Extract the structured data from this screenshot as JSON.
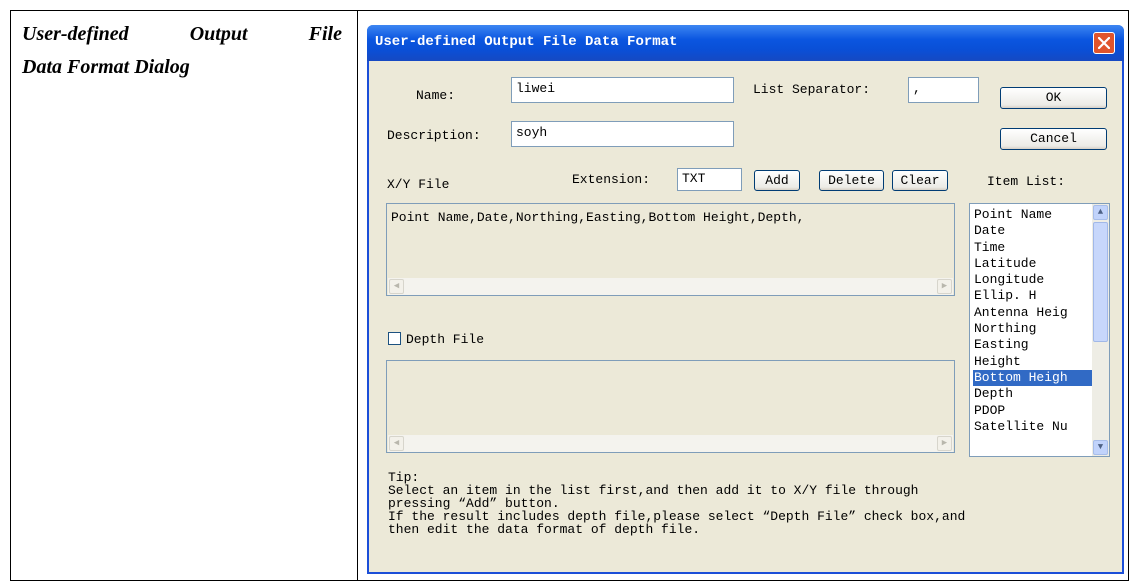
{
  "caption": {
    "line1_words": [
      "User-defined",
      "Output",
      "File"
    ],
    "line2": "Data Format Dialog"
  },
  "dialog": {
    "title": "User-defined Output File Data Format",
    "name_label": "Name:",
    "name_value": "liwei",
    "list_separator_label": "List Separator:",
    "list_separator_value": ",",
    "description_label": "Description:",
    "description_value": "soyh",
    "ok_label": "OK",
    "cancel_label": "Cancel",
    "xy_file_label": "X/Y File",
    "extension_label": "Extension:",
    "extension_value": "TXT",
    "add_label": "Add",
    "delete_label": "Delete",
    "clear_label": "Clear",
    "item_list_label": "Item List:",
    "xy_format_text": "Point Name,Date,Northing,Easting,Bottom Height,Depth,",
    "depth_file_label": "Depth File",
    "depth_file_checked": false,
    "items": [
      "Point Name",
      "Date",
      "Time",
      "Latitude",
      "Longitude",
      "Ellip. H",
      "Antenna Heig",
      "Northing",
      "Easting",
      "Height",
      "Bottom Heigh",
      "Depth",
      "PDOP",
      "Satellite Nu"
    ],
    "selected_item": "Bottom Heigh",
    "tip": [
      "Tip:",
      "Select an item in the list first,and then add it to X/Y file through",
      "pressing “Add” button.",
      "If the result includes depth file,please select “Depth File” check box,and",
      "then edit the data format of depth file."
    ]
  },
  "icons": {
    "close": "close-icon",
    "scroll_left": "scroll-left-arrow-icon",
    "scroll_right": "scroll-right-arrow-icon",
    "scroll_up": "scroll-up-arrow-icon",
    "scroll_down": "scroll-down-arrow-icon"
  },
  "colors": {
    "title_bar": "#0a4fd6",
    "dialog_bg": "#ece9d8",
    "close_button": "#e0542c",
    "selection": "#316ac5"
  }
}
